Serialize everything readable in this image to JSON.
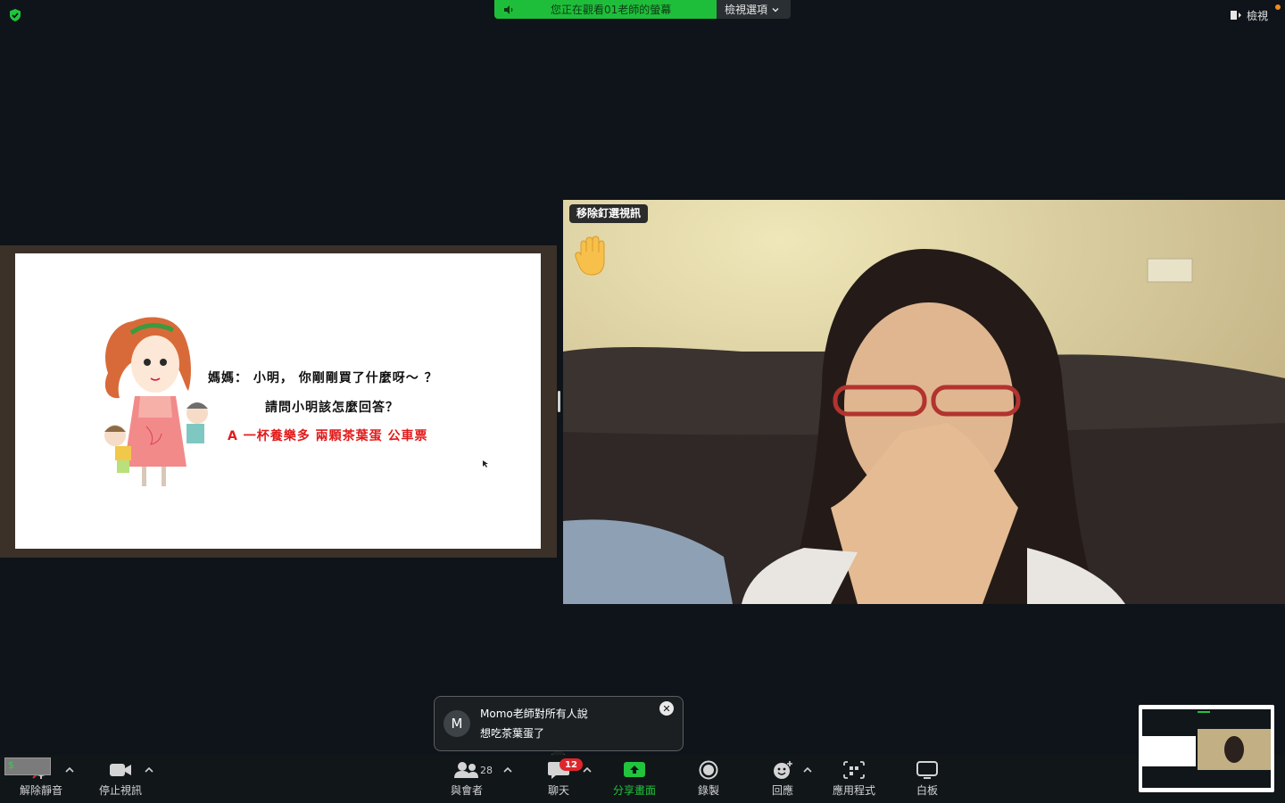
{
  "top_bar": {
    "banner_text": "您正在觀看01老師的螢幕",
    "view_options_label": "檢視選項",
    "view_label": "檢視"
  },
  "slide": {
    "line1": "媽媽：  小明，  你剛剛買了什麼呀～  ？",
    "line2": "請問小明該怎麼回答？",
    "line3": "A 一杯養樂多  兩顆茶葉蛋  公車票"
  },
  "video": {
    "unpin_label": "移除釘選視訊",
    "reaction": "raised-hand"
  },
  "chat_toast": {
    "avatar_letter": "M",
    "from": "Momo老師對所有人說",
    "message": "想吃茶葉蛋了",
    "close_symbol": "✕"
  },
  "toolbar": {
    "unmute": "解除靜音",
    "stop_video": "停止視訊",
    "participants": "與會者",
    "participants_count": "28",
    "chat": "聊天",
    "chat_badge": "12",
    "share_screen": "分享畫面",
    "record": "錄製",
    "reactions": "回應",
    "apps": "應用程式",
    "whiteboard": "白板",
    "mic_level_symbol": "$"
  },
  "colors": {
    "background": "#0e1419",
    "banner": "#1fbe3a",
    "share_green": "#22c33d",
    "badge_red": "#e0262b",
    "slide_red": "#e21a1a"
  }
}
